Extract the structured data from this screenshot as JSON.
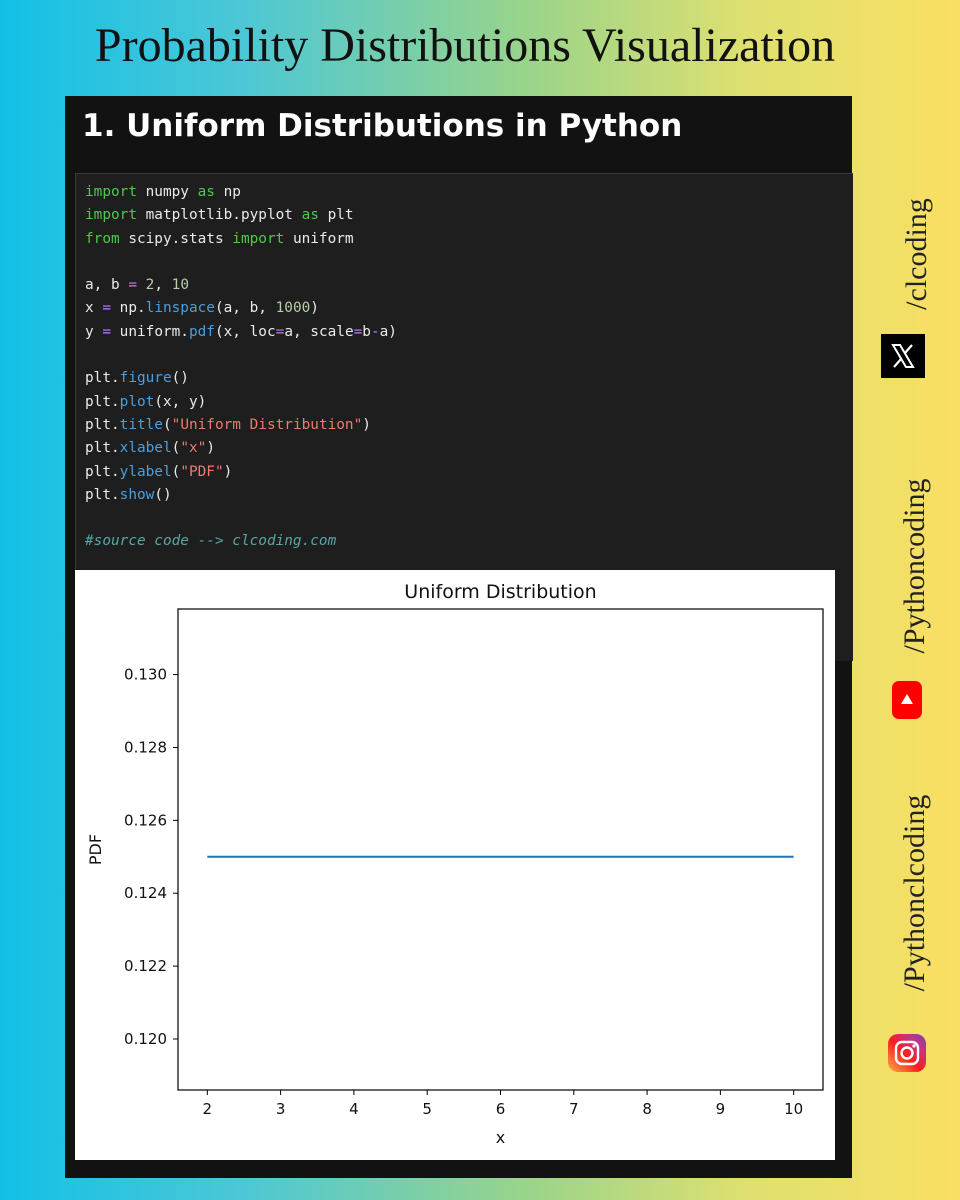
{
  "header": {
    "title": "Probability Distributions Visualization"
  },
  "section": {
    "heading": "1. Uniform Distributions in Python"
  },
  "code": {
    "lines": [
      [
        [
          "kw",
          "import"
        ],
        [
          "t",
          " numpy "
        ],
        [
          "kw",
          "as"
        ],
        [
          "t",
          " np"
        ]
      ],
      [
        [
          "kw",
          "import"
        ],
        [
          "t",
          " matplotlib.pyplot "
        ],
        [
          "kw",
          "as"
        ],
        [
          "t",
          " plt"
        ]
      ],
      [
        [
          "kw",
          "from"
        ],
        [
          "t",
          " scipy.stats "
        ],
        [
          "kw",
          "import"
        ],
        [
          "t",
          " uniform"
        ]
      ],
      [],
      [
        [
          "t",
          "a, b "
        ],
        [
          "op",
          "="
        ],
        [
          "t",
          " "
        ],
        [
          "num",
          "2"
        ],
        [
          "t",
          ", "
        ],
        [
          "num",
          "10"
        ]
      ],
      [
        [
          "t",
          "x "
        ],
        [
          "op",
          "="
        ],
        [
          "t",
          " np."
        ],
        [
          "fn",
          "linspace"
        ],
        [
          "t",
          "(a, b, "
        ],
        [
          "num",
          "1000"
        ],
        [
          "t",
          ")"
        ]
      ],
      [
        [
          "t",
          "y "
        ],
        [
          "op",
          "="
        ],
        [
          "t",
          " uniform."
        ],
        [
          "fn",
          "pdf"
        ],
        [
          "t",
          "(x, loc"
        ],
        [
          "op",
          "="
        ],
        [
          "t",
          "a, scale"
        ],
        [
          "op",
          "="
        ],
        [
          "t",
          "b"
        ],
        [
          "op",
          "-"
        ],
        [
          "t",
          "a)"
        ]
      ],
      [],
      [
        [
          "t",
          "plt."
        ],
        [
          "fn",
          "figure"
        ],
        [
          "t",
          "()"
        ]
      ],
      [
        [
          "t",
          "plt."
        ],
        [
          "fn",
          "plot"
        ],
        [
          "t",
          "(x, y)"
        ]
      ],
      [
        [
          "t",
          "plt."
        ],
        [
          "fn",
          "title"
        ],
        [
          "t",
          "("
        ],
        [
          "str",
          "\"Uniform Distribution\""
        ],
        [
          "t",
          ")"
        ]
      ],
      [
        [
          "t",
          "plt."
        ],
        [
          "fn",
          "xlabel"
        ],
        [
          "t",
          "("
        ],
        [
          "str",
          "\"x\""
        ],
        [
          "t",
          ")"
        ]
      ],
      [
        [
          "t",
          "plt."
        ],
        [
          "fn",
          "ylabel"
        ],
        [
          "t",
          "("
        ],
        [
          "str",
          "\"PDF\""
        ],
        [
          "t",
          ")"
        ]
      ],
      [
        [
          "t",
          "plt."
        ],
        [
          "fn",
          "show"
        ],
        [
          "t",
          "()"
        ]
      ],
      [],
      [
        [
          "comment",
          "#source code --> clcoding.com"
        ]
      ]
    ]
  },
  "chart_data": {
    "type": "line",
    "title": "Uniform Distribution",
    "xlabel": "x",
    "ylabel": "PDF",
    "xlim": [
      1.6,
      10.4
    ],
    "ylim": [
      0.1186,
      0.1318
    ],
    "xticks": [
      2,
      3,
      4,
      5,
      6,
      7,
      8,
      9,
      10
    ],
    "xtick_labels": [
      "2",
      "3",
      "4",
      "5",
      "6",
      "7",
      "8",
      "9",
      "10"
    ],
    "yticks": [
      0.12,
      0.122,
      0.124,
      0.126,
      0.128,
      0.13
    ],
    "ytick_labels": [
      "0.120",
      "0.122",
      "0.124",
      "0.126",
      "0.128",
      "0.130"
    ],
    "grid": false,
    "series": [
      {
        "x": [
          2,
          10
        ],
        "y": [
          0.125,
          0.125
        ],
        "color": "#1f77b4"
      }
    ]
  },
  "social": {
    "twitter_handle": "/clcoding",
    "youtube_handle": "/Pythoncoding",
    "instagram_handle": "/Pythonclcoding",
    "icons": [
      "x-logo-icon",
      "youtube-icon",
      "instagram-icon"
    ]
  },
  "colors": {
    "panel_bg": "#121212",
    "code_bg": "#1e1e1e",
    "keyword": "#4ec94e",
    "operator": "#c77dff",
    "number": "#b5cea8",
    "function": "#4a9fe0",
    "string": "#f07a6a",
    "comment": "#5aa5a5",
    "line": "#1f77b4"
  }
}
